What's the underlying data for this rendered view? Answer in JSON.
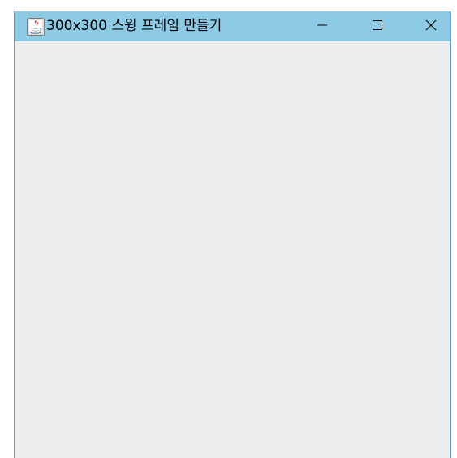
{
  "window": {
    "title": "300x300 스윙 프레임 만들기",
    "icon": "java-icon"
  },
  "titlebar": {
    "background": "#8dcae4",
    "buttons": [
      {
        "name": "minimize",
        "icon": "minimize-icon"
      },
      {
        "name": "maximize",
        "icon": "maximize-icon"
      },
      {
        "name": "close",
        "icon": "close-icon"
      }
    ]
  },
  "content": {
    "background": "#eeeeee"
  }
}
